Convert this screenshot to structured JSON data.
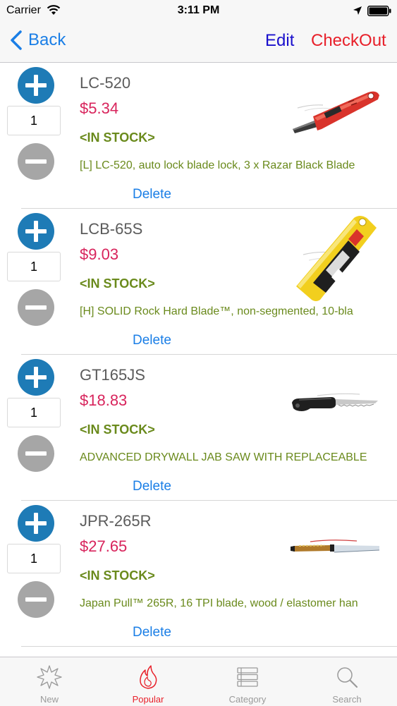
{
  "status_bar": {
    "carrier": "Carrier",
    "time": "3:11 PM"
  },
  "nav": {
    "back_label": "Back",
    "edit_label": "Edit",
    "checkout_label": "CheckOut"
  },
  "products": [
    {
      "code": "LC-520",
      "price": "$5.34",
      "quantity": "1",
      "stock": "<IN STOCK>",
      "description": "[L]  LC-520, auto lock blade lock, 3 x Razar Black Blade",
      "delete_label": "Delete",
      "image": "box-cutter-image"
    },
    {
      "code": "LCB-65S",
      "price": "$9.03",
      "quantity": "1",
      "stock": "<IN STOCK>",
      "description": "[H]  SOLID Rock Hard Blade™, non-segmented, 10-bla",
      "delete_label": "Delete",
      "image": "blade-pack-image"
    },
    {
      "code": "GT165JS",
      "price": "$18.83",
      "quantity": "1",
      "stock": "<IN STOCK>",
      "description": "ADVANCED DRYWALL JAB SAW WITH REPLACEABLE",
      "delete_label": "Delete",
      "image": "jab-saw-image"
    },
    {
      "code": "JPR-265R",
      "price": "$27.65",
      "quantity": "1",
      "stock": "<IN STOCK>",
      "description": "Japan Pull™ 265R, 16 TPI blade, wood / elastomer han",
      "delete_label": "Delete",
      "image": "pull-saw-image"
    }
  ],
  "tabs": [
    {
      "label": "New",
      "icon": "starburst-icon",
      "active": false
    },
    {
      "label": "Popular",
      "icon": "flame-icon",
      "active": true
    },
    {
      "label": "Category",
      "icon": "list-icon",
      "active": false
    },
    {
      "label": "Search",
      "icon": "search-icon",
      "active": false
    }
  ],
  "colors": {
    "accent_blue": "#1a7ee6",
    "edit_blue": "#1a10cc",
    "checkout_red": "#e8202a",
    "price_red": "#d8245c",
    "stock_green": "#6a8a1c",
    "plus_blue": "#1e7bb6",
    "minus_grey": "#a6a6a6"
  }
}
